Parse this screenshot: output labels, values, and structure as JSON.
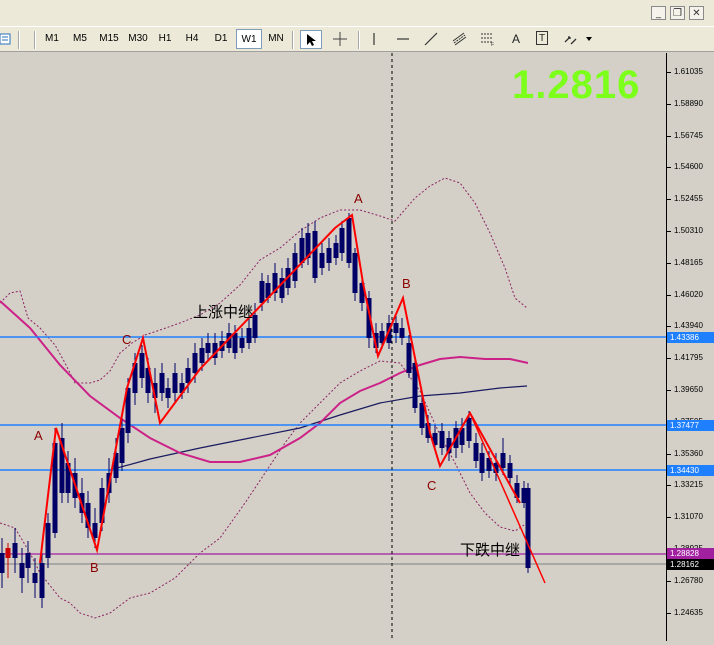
{
  "window": {
    "minimize_label": "_",
    "restore_label": "❐",
    "close_label": "✕"
  },
  "toolbar": {
    "timeframes": [
      "M1",
      "M5",
      "M15",
      "M30",
      "H1",
      "H4",
      "D1",
      "W1",
      "MN"
    ],
    "active_timeframe": "W1",
    "text_tool_label": "A",
    "label_tool_label": "T"
  },
  "price_axis": {
    "ticks": [
      "1.61035",
      "1.58890",
      "1.56745",
      "1.54600",
      "1.52455",
      "1.50310",
      "1.48165",
      "1.46020",
      "1.43940",
      "1.41795",
      "1.39650",
      "1.37505",
      "1.35360",
      "1.33215",
      "1.31070",
      "1.28925",
      "1.26780",
      "1.24635"
    ],
    "tags": {
      "line1": "1.43386",
      "line2": "1.37477",
      "line3": "1.34430",
      "line4": "1.28828",
      "current": "1.28162"
    }
  },
  "big_price": "1.2816",
  "wave_labels": {
    "a1": "A",
    "b1": "B",
    "c1": "C",
    "a2": "A",
    "b2": "B",
    "c2": "C"
  },
  "notes": {
    "up": "上涨中继",
    "down": "下跌中继"
  },
  "colors": {
    "candle_up": "#cc0000",
    "candle_down": "#000066",
    "hline_blue": "#1e7fff",
    "hline_purple": "#a020a0",
    "ma_magenta": "#cc2288",
    "ma_navy": "#1a1a60",
    "trend_red": "#ff0000",
    "big_price": "#7cff1a"
  }
}
